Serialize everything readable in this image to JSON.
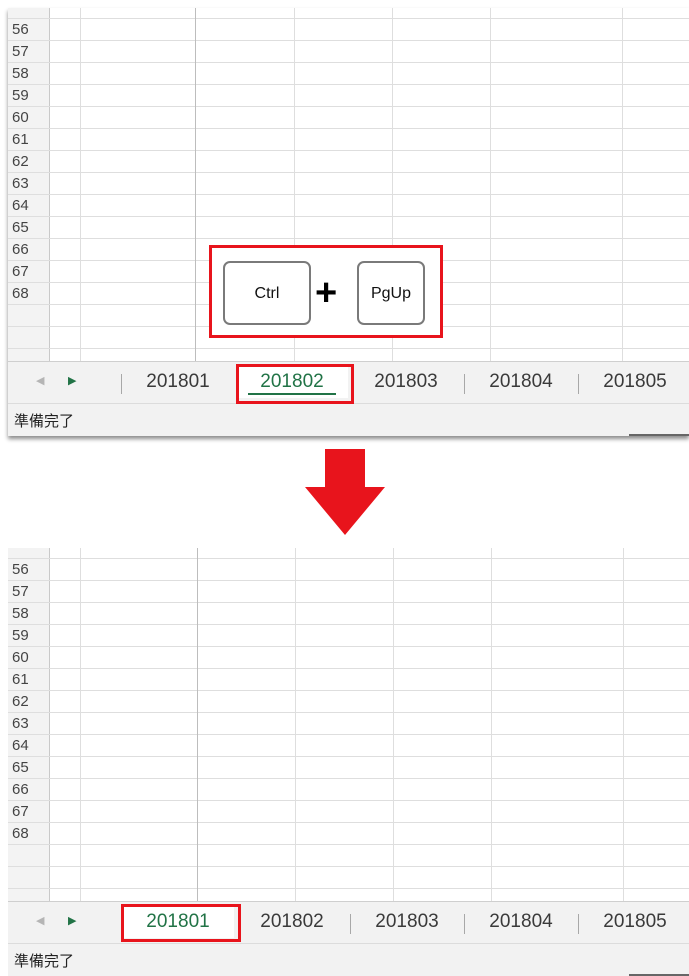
{
  "row_numbers": [
    "56",
    "57",
    "58",
    "59",
    "60",
    "61",
    "62",
    "63",
    "64",
    "65",
    "66",
    "67",
    "68"
  ],
  "before": {
    "tabs": [
      "201801",
      "201802",
      "201803",
      "201804",
      "201805"
    ],
    "active_tab": "201802",
    "status": "準備完了",
    "shortcut": {
      "key1": "Ctrl",
      "plus": "+",
      "key2": "PgUp"
    }
  },
  "after": {
    "tabs": [
      "201801",
      "201802",
      "201803",
      "201804",
      "201805"
    ],
    "active_tab": "201801",
    "status": "準備完了"
  },
  "colors": {
    "highlight_red": "#e8141c",
    "active_tab_green": "#217346",
    "arrow_red": "#e8141c"
  },
  "icons": {
    "scroll_left": "◀",
    "scroll_right": "▶",
    "transition_arrow": "arrow-down-icon"
  }
}
